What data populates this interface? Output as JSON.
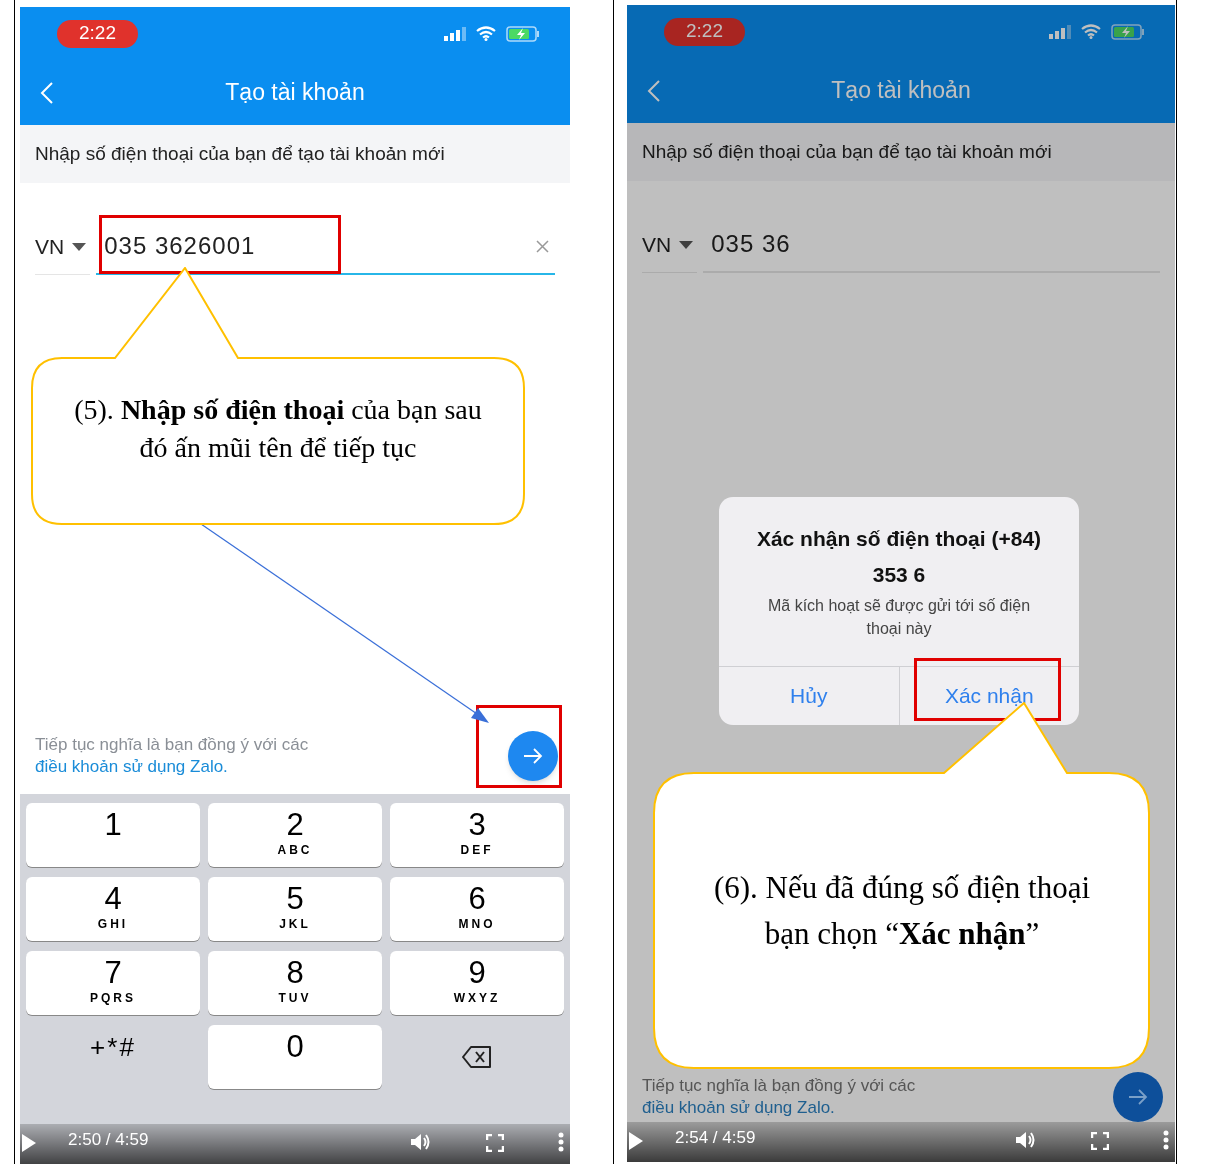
{
  "panels": [
    {
      "status_time": "2:22",
      "title": "Tạo tài khoản",
      "subtitle": "Nhập số điện thoại của bạn để tạo tài khoản mới",
      "country": "VN",
      "phone": "035 3626001",
      "clearable": true,
      "dimmed": false,
      "terms": "Tiếp tục nghĩa là bạn đồng ý với các ",
      "terms_link": "điều khoản sử dụng Zalo.",
      "keypad": [
        {
          "kind": "digit",
          "digit": "1"
        },
        {
          "kind": "digit",
          "digit": "2",
          "letters": "ABC"
        },
        {
          "kind": "digit",
          "digit": "3",
          "letters": "DEF"
        },
        {
          "kind": "digit",
          "digit": "4",
          "letters": "GHI"
        },
        {
          "kind": "digit",
          "digit": "5",
          "letters": "JKL"
        },
        {
          "kind": "digit",
          "digit": "6",
          "letters": "MNO"
        },
        {
          "kind": "digit",
          "digit": "7",
          "letters": "PQRS"
        },
        {
          "kind": "digit",
          "digit": "8",
          "letters": "TUV"
        },
        {
          "kind": "digit",
          "digit": "9",
          "letters": "WXYZ"
        },
        {
          "kind": "symbols",
          "digit": "+*#"
        },
        {
          "kind": "digit",
          "digit": "0"
        },
        {
          "kind": "delete"
        }
      ],
      "video_time": "2:50 / 4:59",
      "callout": "(5). **Nhập số điện thoại** của bạn sau đó ấn mũi tên để tiếp tục"
    },
    {
      "status_time": "2:22",
      "title": "Tạo tài khoản",
      "subtitle": "Nhập số điện thoại của bạn để tạo tài khoản mới",
      "country": "VN",
      "phone": "035 36",
      "clearable": false,
      "dimmed": true,
      "terms": "Tiếp tục nghĩa là bạn đồng ý với các ",
      "terms_link": "điều khoản sử dụng Zalo.",
      "dialog": {
        "title": "Xác nhận số điện thoại (+84)",
        "number": "353 6",
        "message": "Mã kích hoạt sẽ được gửi tới số điện thoại này",
        "buttons": [
          "Hủy",
          "Xác nhận"
        ]
      },
      "video_time": "2:54 / 4:59",
      "callout": "(6). Nếu đã đúng số điện thoại bạn chọn “**Xác nhận**”"
    }
  ]
}
